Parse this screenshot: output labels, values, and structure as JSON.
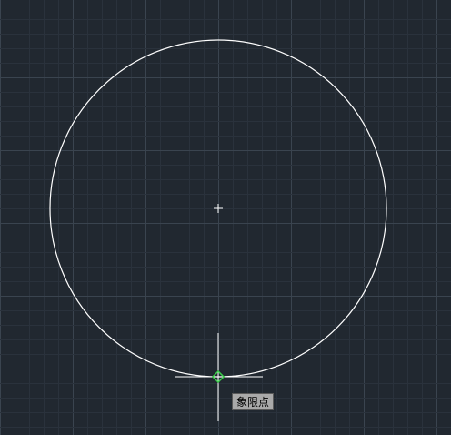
{
  "viewport": {
    "background_color": "#212830",
    "grid_minor_color": "#2a323c",
    "grid_major_color": "#3a444f"
  },
  "drawing": {
    "circle": {
      "stroke_color": "#ffffff",
      "center_marker_color": "#ffffff"
    },
    "crosshair": {
      "color": "#ffffff"
    },
    "snap_marker": {
      "color": "#3ad14a",
      "type": "quadrant"
    }
  },
  "osnap_tooltip": {
    "label": "象限点"
  }
}
